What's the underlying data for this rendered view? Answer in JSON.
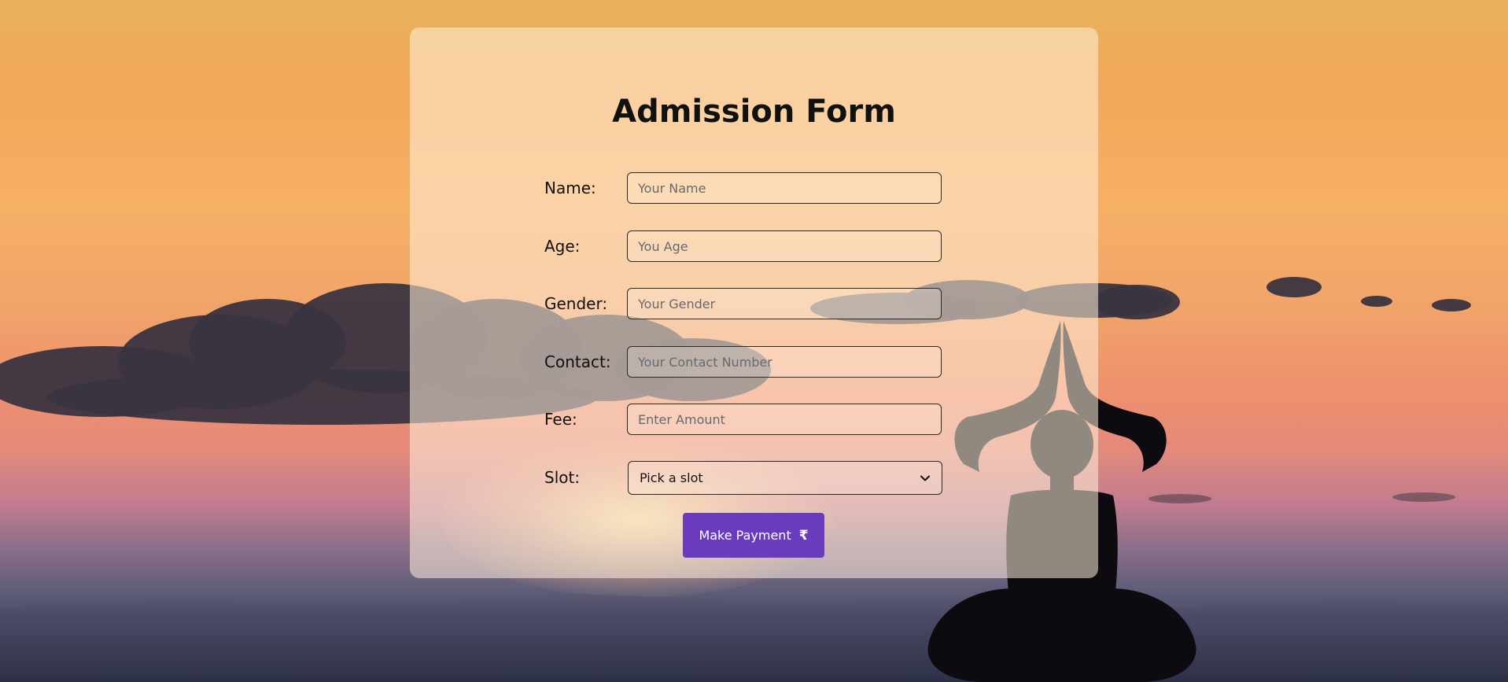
{
  "form": {
    "title": "Admission Form",
    "fields": [
      {
        "label": "Name:",
        "placeholder": "Your Name"
      },
      {
        "label": "Age:",
        "placeholder": "You Age"
      },
      {
        "label": "Gender:",
        "placeholder": "Your Gender"
      },
      {
        "label": "Contact:",
        "placeholder": "Your Contact Number"
      },
      {
        "label": "Fee:",
        "placeholder": "Enter Amount"
      }
    ],
    "slot": {
      "label": "Slot:",
      "selected": "Pick a slot"
    },
    "submit": {
      "label": "Make Payment",
      "icon_glyph": "₹",
      "icon_name": "rupee-icon"
    }
  },
  "colors": {
    "button": "#6a3cbd",
    "card": "rgba(255,240,220,0.55)"
  }
}
